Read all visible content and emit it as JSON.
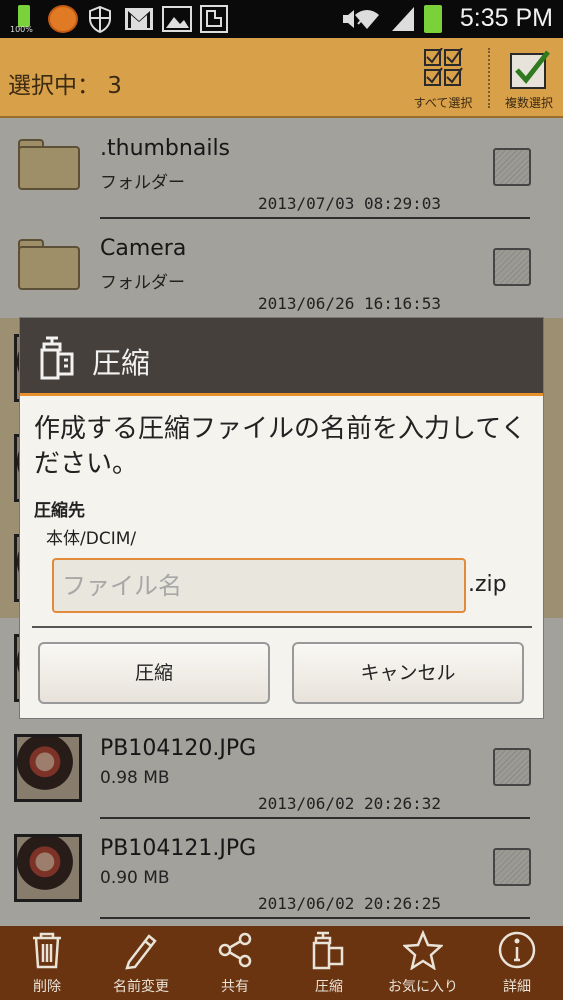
{
  "status_bar": {
    "battery_text": "100%",
    "time": "5:35 PM"
  },
  "header": {
    "selection_label": "選択中： 3",
    "select_all_label": "すべて選択",
    "multi_select_label": "複数選択"
  },
  "files": [
    {
      "name": ".thumbnails",
      "sub": "フォルダー",
      "date": "2013/07/03 08:29:03",
      "type": "folder"
    },
    {
      "name": "Camera",
      "sub": "フォルダー",
      "date": "2013/06/26 16:16:53",
      "type": "folder"
    },
    {
      "name": "PB104120.JPG",
      "sub": "0.98 MB",
      "date": "2013/06/02 20:26:32",
      "type": "image"
    },
    {
      "name": "PB104121.JPG",
      "sub": "0.90 MB",
      "date": "2013/06/02 20:26:25",
      "type": "image"
    }
  ],
  "dialog": {
    "title": "圧縮",
    "message": "作成する圧縮ファイルの名前を入力してください。",
    "dest_label": "圧縮先",
    "dest_path": "本体/DCIM/",
    "input_placeholder": "ファイル名",
    "input_value": "",
    "extension": ".zip",
    "ok_label": "圧縮",
    "cancel_label": "キャンセル"
  },
  "bottom_bar": {
    "items": [
      {
        "label": "削除",
        "icon": "trash-icon"
      },
      {
        "label": "名前変更",
        "icon": "pencil-icon"
      },
      {
        "label": "共有",
        "icon": "share-icon"
      },
      {
        "label": "圧縮",
        "icon": "compress-icon"
      },
      {
        "label": "お気に入り",
        "icon": "star-icon"
      },
      {
        "label": "詳細",
        "icon": "info-icon"
      }
    ]
  },
  "colors": {
    "header_bg": "#d9a04a",
    "dialog_header_bg": "#45403b",
    "accent": "#e8902e",
    "bottom_bar_bg": "#6a3410"
  }
}
